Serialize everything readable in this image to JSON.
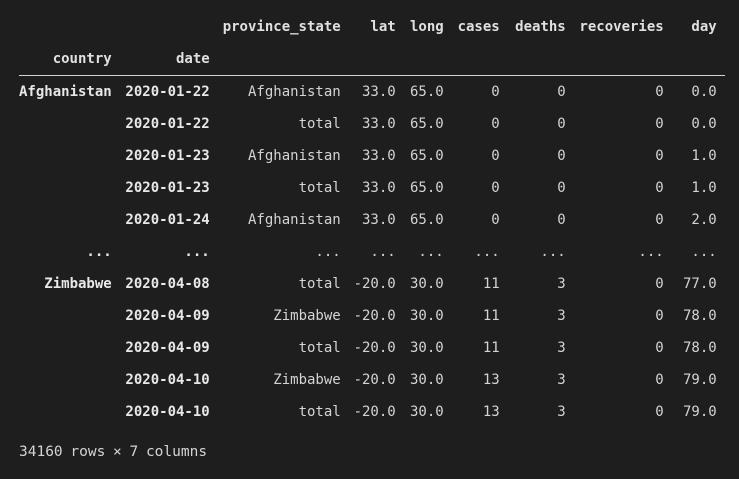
{
  "dataframe": {
    "columns": [
      "province_state",
      "lat",
      "long",
      "cases",
      "deaths",
      "recoveries",
      "day"
    ],
    "index_names": [
      "country",
      "date"
    ],
    "rows": [
      {
        "country": "Afghanistan",
        "date": "2020-01-22",
        "values": [
          "Afghanistan",
          "33.0",
          "65.0",
          "0",
          "0",
          "0",
          "0.0"
        ]
      },
      {
        "country": "",
        "date": "2020-01-22",
        "values": [
          "total",
          "33.0",
          "65.0",
          "0",
          "0",
          "0",
          "0.0"
        ]
      },
      {
        "country": "",
        "date": "2020-01-23",
        "values": [
          "Afghanistan",
          "33.0",
          "65.0",
          "0",
          "0",
          "0",
          "1.0"
        ]
      },
      {
        "country": "",
        "date": "2020-01-23",
        "values": [
          "total",
          "33.0",
          "65.0",
          "0",
          "0",
          "0",
          "1.0"
        ]
      },
      {
        "country": "",
        "date": "2020-01-24",
        "values": [
          "Afghanistan",
          "33.0",
          "65.0",
          "0",
          "0",
          "0",
          "2.0"
        ]
      },
      {
        "country": "...",
        "date": "...",
        "values": [
          "...",
          "...",
          "...",
          "...",
          "...",
          "...",
          "..."
        ]
      },
      {
        "country": "Zimbabwe",
        "date": "2020-04-08",
        "values": [
          "total",
          "-20.0",
          "30.0",
          "11",
          "3",
          "0",
          "77.0"
        ]
      },
      {
        "country": "",
        "date": "2020-04-09",
        "values": [
          "Zimbabwe",
          "-20.0",
          "30.0",
          "11",
          "3",
          "0",
          "78.0"
        ]
      },
      {
        "country": "",
        "date": "2020-04-09",
        "values": [
          "total",
          "-20.0",
          "30.0",
          "11",
          "3",
          "0",
          "78.0"
        ]
      },
      {
        "country": "",
        "date": "2020-04-10",
        "values": [
          "Zimbabwe",
          "-20.0",
          "30.0",
          "13",
          "3",
          "0",
          "79.0"
        ]
      },
      {
        "country": "",
        "date": "2020-04-10",
        "values": [
          "total",
          "-20.0",
          "30.0",
          "13",
          "3",
          "0",
          "79.0"
        ]
      }
    ],
    "shape_text": "34160 rows × 7 columns"
  }
}
